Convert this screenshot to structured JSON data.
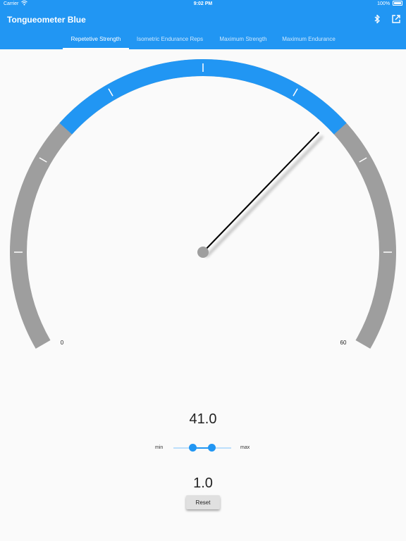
{
  "status_bar": {
    "carrier": "Carrier",
    "time": "9:02 PM",
    "battery": "100%"
  },
  "app_bar": {
    "title": "Tongueometer Blue",
    "actions": [
      "bluetooth-icon",
      "open-in-new-icon"
    ]
  },
  "tabs": [
    {
      "label": "Repetetive Strength",
      "active": true
    },
    {
      "label": "Isometric Endurance Reps",
      "active": false
    },
    {
      "label": "Maximum Strength",
      "active": false
    },
    {
      "label": "Maximum Endurance",
      "active": false
    }
  ],
  "gauge": {
    "min_label": "0",
    "max_label": "60",
    "min": 0,
    "max": 60,
    "value": 41.0,
    "highlight_range": [
      18,
      42
    ],
    "colors": {
      "track": "#9e9e9e",
      "highlight": "#2196f3",
      "needle": "#000000",
      "hub": "#9e9e9e",
      "tick": "#ffffff"
    }
  },
  "readout": {
    "value": "41.0"
  },
  "range_slider": {
    "min_label": "min",
    "max_label": "max",
    "lower_fraction": 0.33,
    "upper_fraction": 0.66
  },
  "threshold": {
    "value": "1.0"
  },
  "reset_button": {
    "label": "Reset"
  },
  "colors": {
    "primary": "#2196f3",
    "background": "#fafafa"
  }
}
